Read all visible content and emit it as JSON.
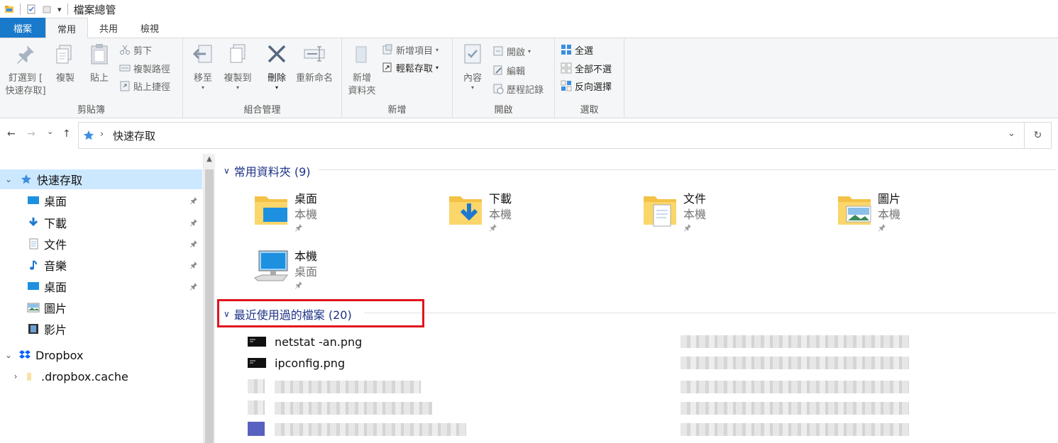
{
  "window": {
    "title": "檔案總管"
  },
  "ribbon_tabs": [
    {
      "label": "檔案",
      "kind": "file"
    },
    {
      "label": "常用",
      "kind": "active"
    },
    {
      "label": "共用",
      "kind": "normal"
    },
    {
      "label": "檢視",
      "kind": "normal"
    }
  ],
  "ribbon": {
    "clipboard": {
      "label": "剪貼簿",
      "pin_line1": "釘選到 [",
      "pin_line2": "快速存取]",
      "copy": "複製",
      "paste": "貼上",
      "cut": "剪下",
      "copy_path": "複製路徑",
      "paste_shortcut": "貼上捷徑"
    },
    "organize": {
      "label": "組合管理",
      "move_to": "移至",
      "copy_to": "複製到",
      "delete": "刪除",
      "rename": "重新命名"
    },
    "new": {
      "label": "新增",
      "new_folder_line1": "新增",
      "new_folder_line2": "資料夾",
      "new_item": "新增項目",
      "easy_access": "輕鬆存取"
    },
    "open": {
      "label": "開啟",
      "properties": "內容",
      "open": "開啟",
      "edit": "編輯",
      "history": "歷程記錄"
    },
    "select": {
      "label": "選取",
      "select_all": "全選",
      "select_none": "全部不選",
      "invert": "反向選擇"
    }
  },
  "address": {
    "path": "快速存取",
    "back": "←",
    "forward": "→",
    "recent": "⌄",
    "up": "↑",
    "dropdown": "⌄",
    "refresh": "↻"
  },
  "nav": {
    "items": [
      {
        "label": "快速存取",
        "icon": "star-icon",
        "pinned": false,
        "selected": true,
        "expander": "⌄",
        "indent": 0
      },
      {
        "label": "桌面",
        "icon": "desktop-icon",
        "pinned": true,
        "indent": 1
      },
      {
        "label": "下載",
        "icon": "download-icon",
        "pinned": true,
        "indent": 1
      },
      {
        "label": "文件",
        "icon": "document-icon",
        "pinned": true,
        "indent": 1
      },
      {
        "label": "音樂",
        "icon": "music-icon",
        "pinned": true,
        "indent": 1
      },
      {
        "label": "桌面",
        "icon": "desktop-icon",
        "pinned": true,
        "indent": 1
      },
      {
        "label": "圖片",
        "icon": "pictures-icon",
        "pinned": false,
        "indent": 1
      },
      {
        "label": "影片",
        "icon": "video-icon",
        "pinned": false,
        "indent": 1
      },
      {
        "label": "Dropbox",
        "icon": "dropbox-icon",
        "pinned": false,
        "expander": "⌄",
        "indent": 0
      },
      {
        "label": ".dropbox.cache",
        "icon": "folder-icon",
        "pinned": false,
        "expander": "›",
        "indent": 1
      }
    ]
  },
  "content": {
    "frequent": {
      "header": "常用資料夾 (9)",
      "folders": [
        {
          "name": "桌面",
          "location": "本機",
          "icon": "desktop-folder-icon"
        },
        {
          "name": "下載",
          "location": "本機",
          "icon": "download-folder-icon"
        },
        {
          "name": "文件",
          "location": "本機",
          "icon": "documents-folder-icon"
        },
        {
          "name": "圖片",
          "location": "本機",
          "icon": "pictures-folder-icon"
        },
        {
          "name": "本機",
          "location": "桌面",
          "icon": "this-pc-icon"
        }
      ]
    },
    "recent": {
      "header": "最近使用過的檔案 (20)",
      "files": [
        {
          "name": "netstat -an.png",
          "icon": "terminal-image-icon"
        },
        {
          "name": "ipconfig.png",
          "icon": "terminal-image-icon"
        }
      ]
    }
  },
  "colors": {
    "accent": "#1979ca",
    "selection": "#cce8ff",
    "section_text": "#1e3287",
    "highlight": "#e0141e"
  }
}
